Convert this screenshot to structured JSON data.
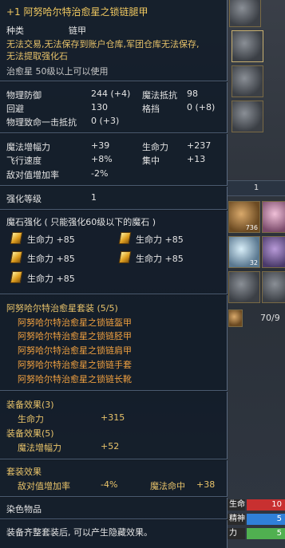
{
  "item": {
    "title": "+1 阿努哈尔特治愈星之锁链腿甲",
    "type_label": "种类",
    "type_value": "链甲",
    "restrictions": [
      "无法交易,无法保存到账户仓库,军团仓库无法保存,",
      "无法提取强化石"
    ],
    "class_req": "治愈星 50级以上可以使用"
  },
  "stats_basic": [
    {
      "label": "物理防御",
      "value": "244 (+4)",
      "label2": "魔法抵抗",
      "value2": "98"
    },
    {
      "label": "回避",
      "value": "130",
      "label2": "格挡",
      "value2": "0 (+8)"
    },
    {
      "label": "物理致命一击抵抗",
      "value": "0 (+3)"
    }
  ],
  "stats_magic": [
    {
      "label": "魔法增幅力",
      "value": "+39",
      "label2": "生命力",
      "value2": "+237"
    },
    {
      "label": "飞行速度",
      "value": "+8%",
      "label2": "集中",
      "value2": "+13"
    },
    {
      "label": "敌对值增加率",
      "value": "-2%"
    }
  ],
  "enchant": {
    "label": "强化等级",
    "value": "1"
  },
  "manastone": {
    "header": "魔石强化 ( 只能强化60级以下的魔石 )",
    "stones": [
      "生命力 +85",
      "生命力 +85",
      "生命力 +85",
      "生命力 +85",
      "生命力 +85"
    ]
  },
  "set": {
    "header": "阿努哈尔特治愈星套装 (5/5)",
    "pieces": [
      "阿努哈尔特治愈星之锁链盔甲",
      "阿努哈尔特治愈星之锁链胫甲",
      "阿努哈尔特治愈星之锁链肩甲",
      "阿努哈尔特治愈星之锁链手套",
      "阿努哈尔特治愈星之锁链长靴"
    ],
    "effect3_label": "装备效果(3)",
    "effect3_stat": "生命力",
    "effect3_value": "+315",
    "effect5_label": "装备效果(5)",
    "effect5_stat": "魔法增幅力",
    "effect5_value": "+52"
  },
  "set_bonus": {
    "header": "套装效果",
    "stat1": "敌对值增加率",
    "value1": "-4%",
    "stat2": "魔法命中",
    "value2": "+38"
  },
  "dye": "染色物品",
  "footer": "装备齐整套装后, 可以产生隐藏效果。",
  "background_ui": {
    "bar_value": "1",
    "slot_counts": [
      "736",
      "32"
    ],
    "box_count": "70/9",
    "hp_label": "生命",
    "hp_value": "10",
    "mp_label": "精神",
    "mp_value": "5",
    "dp_label": "力",
    "dp_value": "5"
  }
}
